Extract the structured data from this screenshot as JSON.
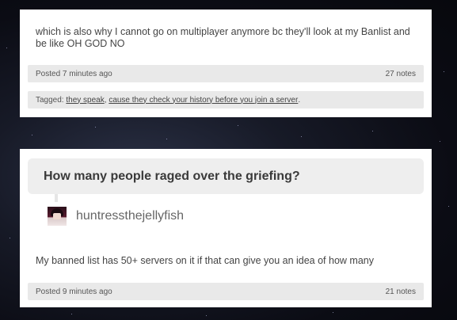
{
  "post1": {
    "body": "which is also why I cannot go on multiplayer anymore bc they'll look at my Banlist and be like OH GOD NO",
    "posted": "Posted 7 minutes ago",
    "notes": "27 notes",
    "tags_label": "Tagged:",
    "tags": [
      "they speak",
      "cause they check your history before you join a server"
    ],
    "tag_sep": ",",
    "tag_end": "."
  },
  "post2": {
    "question": "How many people raged over the griefing?",
    "asker": "huntressthejellyfish",
    "answer": "My banned list has 50+ servers on it if that can give you an idea of how many",
    "posted": "Posted 9 minutes ago",
    "notes": "21 notes"
  },
  "colors": {
    "background": "#0b0c14",
    "card": "#ffffff",
    "meta_bar": "#e9e9e9",
    "question_bg": "#eeeeee"
  }
}
